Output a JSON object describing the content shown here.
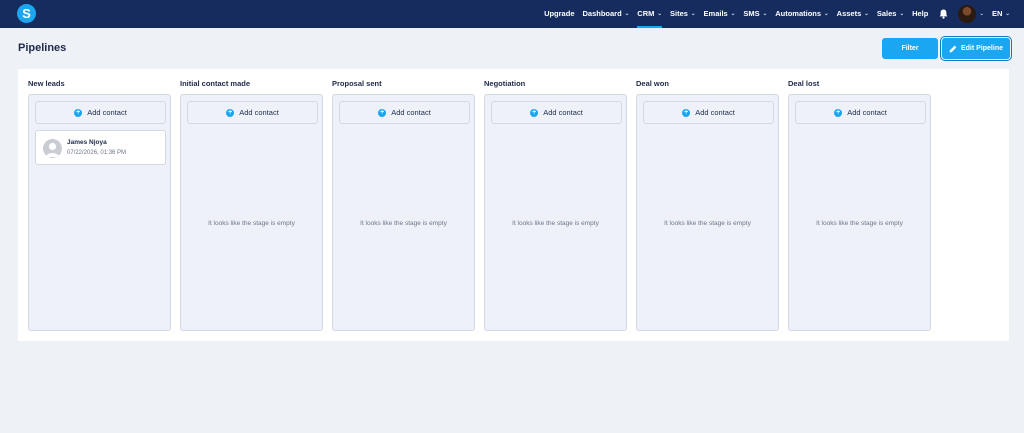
{
  "app": {
    "logo_letter": "S"
  },
  "nav": {
    "items": [
      {
        "label": "Upgrade",
        "dropdown": false,
        "active": false
      },
      {
        "label": "Dashboard",
        "dropdown": true,
        "active": false
      },
      {
        "label": "CRM",
        "dropdown": true,
        "active": true
      },
      {
        "label": "Sites",
        "dropdown": true,
        "active": false
      },
      {
        "label": "Emails",
        "dropdown": true,
        "active": false
      },
      {
        "label": "SMS",
        "dropdown": true,
        "active": false
      },
      {
        "label": "Automations",
        "dropdown": true,
        "active": false
      },
      {
        "label": "Assets",
        "dropdown": true,
        "active": false
      },
      {
        "label": "Sales",
        "dropdown": true,
        "active": false
      },
      {
        "label": "Help",
        "dropdown": false,
        "active": false
      }
    ],
    "language": "EN"
  },
  "page": {
    "title": "Pipelines",
    "filter_label": "Filter",
    "edit_pipeline_label": "Edit Pipeline"
  },
  "stages": [
    {
      "title": "New leads",
      "add_label": "Add contact",
      "empty_text": "",
      "cards": [
        {
          "name": "James Njoya",
          "date": "07/22/2026, 01:36 PM"
        }
      ]
    },
    {
      "title": "Initial contact made",
      "add_label": "Add contact",
      "empty_text": "It looks like the stage is empty",
      "cards": []
    },
    {
      "title": "Proposal sent",
      "add_label": "Add contact",
      "empty_text": "It looks like the stage is empty",
      "cards": []
    },
    {
      "title": "Negotiation",
      "add_label": "Add contact",
      "empty_text": "It looks like the stage is empty",
      "cards": []
    },
    {
      "title": "Deal won",
      "add_label": "Add contact",
      "empty_text": "It looks like the stage is empty",
      "cards": []
    },
    {
      "title": "Deal lost",
      "add_label": "Add contact",
      "empty_text": "It looks like the stage is empty",
      "cards": []
    }
  ],
  "colors": {
    "navbar": "#162c5e",
    "accent": "#1aa6f0",
    "background": "#eef2f7"
  },
  "icons": {
    "notifications": "bell-icon",
    "add": "plus-circle-icon",
    "edit": "pencil-icon",
    "dropdown": "chevron-down-icon"
  }
}
